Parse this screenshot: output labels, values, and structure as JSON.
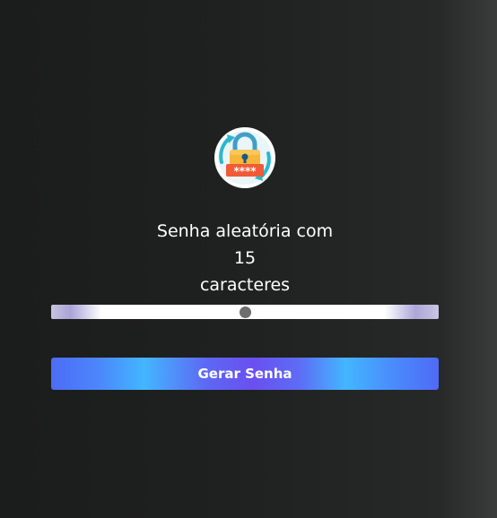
{
  "header": {
    "logo_icon": "padlock-password-icon",
    "logo_password_mask": "****"
  },
  "main": {
    "title_prefix": "Senha aleatória com",
    "length_value": "15",
    "title_suffix": "caracteres"
  },
  "slider": {
    "value": 15,
    "min": 5,
    "max": 25
  },
  "actions": {
    "generate_label": "Gerar Senha"
  },
  "colors": {
    "background": "#1f2020",
    "button_primary": "#4d6cf6",
    "button_highlight": "#43b6ff",
    "slider_thumb": "#6e6e6e"
  }
}
